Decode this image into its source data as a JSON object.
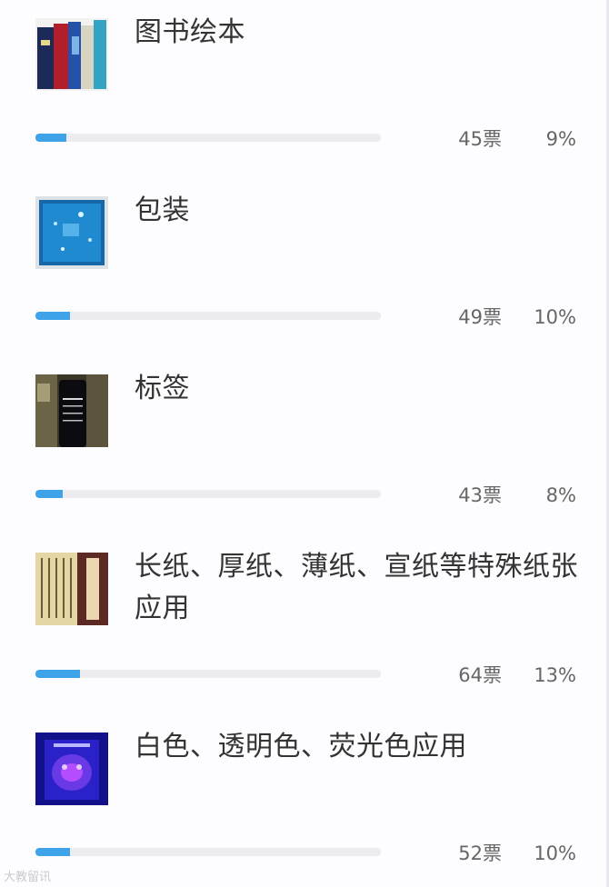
{
  "poll": {
    "items": [
      {
        "label": "图书绘本",
        "votes": "45票",
        "percent": "9%",
        "fraction": 0.09
      },
      {
        "label": "包装",
        "votes": "49票",
        "percent": "10%",
        "fraction": 0.1
      },
      {
        "label": "标签",
        "votes": "43票",
        "percent": "8%",
        "fraction": 0.08
      },
      {
        "label": "长纸、厚纸、薄纸、宣纸等特殊纸张应用",
        "votes": "64票",
        "percent": "13%",
        "fraction": 0.13
      },
      {
        "label": "白色、透明色、荧光色应用",
        "votes": "52票",
        "percent": "10%",
        "fraction": 0.1
      }
    ]
  },
  "watermark": "大教留讯",
  "colors": {
    "bar_fill": "#3ea3e8",
    "bar_track": "#ececef",
    "text": "#333333",
    "meta_text": "#666666"
  }
}
